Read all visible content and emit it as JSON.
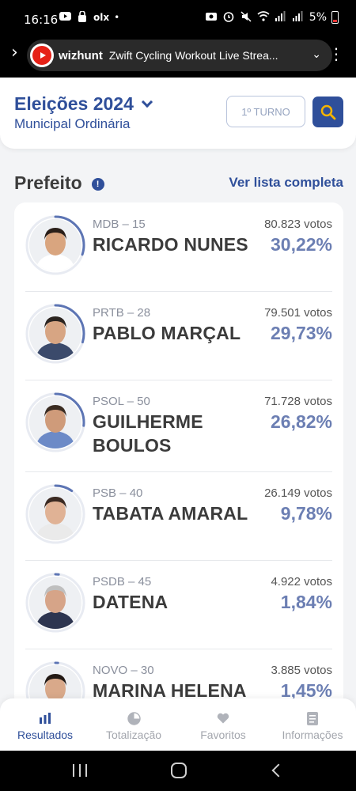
{
  "status_bar": {
    "time": "16:16",
    "left_icons": [
      "youtube-icon",
      "lock-icon",
      "olx-icon",
      "dot-icon"
    ],
    "olx_text": "olx",
    "battery": "5%",
    "right_icons": [
      "camera-icon",
      "alarm-icon",
      "mute-icon",
      "wifi-icon",
      "signal-icon",
      "signal-icon",
      "battery-icon"
    ]
  },
  "media_notification": {
    "source": "wizhunt",
    "title": "Zwift Cycling Workout Live Strea..."
  },
  "header": {
    "title": "Eleições 2024",
    "subtitle": "Municipal Ordinária",
    "turno_label": "1º TURNO"
  },
  "section": {
    "title": "Prefeito",
    "see_all": "Ver lista completa"
  },
  "colors": {
    "brand": "#2f4f9a",
    "percent": "#6c7fb3",
    "ring": "#5d75b4"
  },
  "candidates": [
    {
      "party": "MDB – 15",
      "name_lines": [
        "RICARDO NUNES"
      ],
      "votes": "80.823 votos",
      "percent": "30,22%",
      "share": 0.3022
    },
    {
      "party": "PRTB – 28",
      "name_lines": [
        "PABLO MARÇAL"
      ],
      "votes": "79.501 votos",
      "percent": "29,73%",
      "share": 0.2973
    },
    {
      "party": "PSOL – 50",
      "name_lines": [
        "GUILHERME",
        "BOULOS"
      ],
      "votes": "71.728 votos",
      "percent": "26,82%",
      "share": 0.2682
    },
    {
      "party": "PSB – 40",
      "name_lines": [
        "TABATA AMARAL"
      ],
      "votes": "26.149 votos",
      "percent": "9,78%",
      "share": 0.0978
    },
    {
      "party": "PSDB – 45",
      "name_lines": [
        "DATENA"
      ],
      "votes": "4.922 votos",
      "percent": "1,84%",
      "share": 0.0184
    },
    {
      "party": "NOVO – 30",
      "name_lines": [
        "MARINA HELENA"
      ],
      "votes": "3.885 votos",
      "percent": "1,45%",
      "share": 0.0145
    }
  ],
  "bottom_nav": [
    {
      "label": "Resultados",
      "icon": "bar-chart-icon",
      "active": true
    },
    {
      "label": "Totalização",
      "icon": "pie-chart-icon",
      "active": false
    },
    {
      "label": "Favoritos",
      "icon": "heart-icon",
      "active": false
    },
    {
      "label": "Informações",
      "icon": "document-icon",
      "active": false
    }
  ],
  "system_nav": [
    "recent-apps-icon",
    "home-icon",
    "back-icon"
  ]
}
